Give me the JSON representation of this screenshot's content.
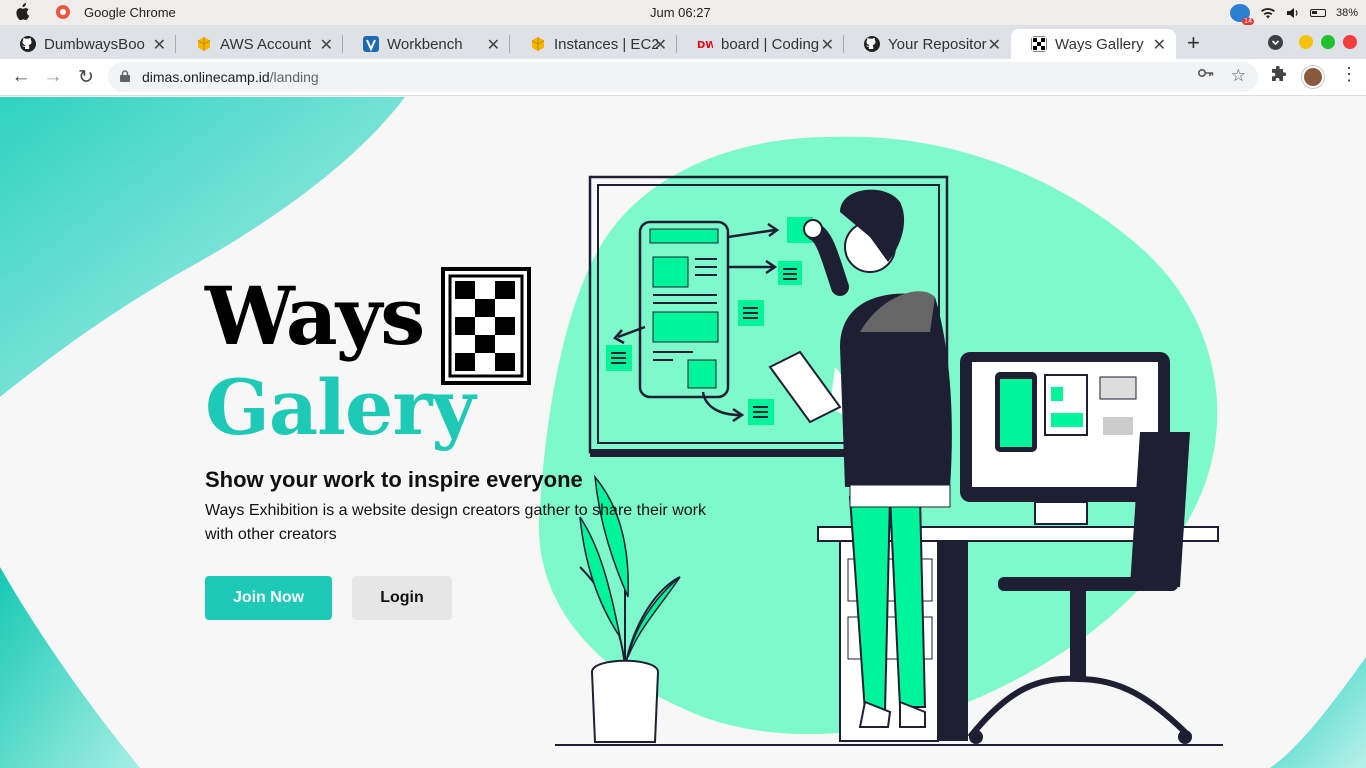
{
  "menubar": {
    "app_name": "Google Chrome",
    "clock": "Jum 06:27",
    "notification_count": "14",
    "battery": "38%"
  },
  "tabs": [
    {
      "label": "DumbwaysBoo",
      "icon": "github-icon"
    },
    {
      "label": "AWS Account",
      "icon": "aws-icon"
    },
    {
      "label": "Workbench",
      "icon": "workbench-icon"
    },
    {
      "label": "Instances | EC2",
      "icon": "aws-icon"
    },
    {
      "label": "board | Coding",
      "icon": "dumbways-icon"
    },
    {
      "label": "Your Repositor",
      "icon": "github-icon"
    },
    {
      "label": "Ways Gallery",
      "icon": "checker-icon",
      "active": true
    }
  ],
  "address": {
    "host": "dimas.onlinecamp.id",
    "path": "/landing"
  },
  "hero": {
    "logo_word1": "Ways",
    "logo_word2": "Galery",
    "tagline": "Show your work to inspire everyone",
    "description": "Ways Exhibition is a website design creators gather to share their work with other creators",
    "join_label": "Join Now",
    "login_label": "Login"
  },
  "colors": {
    "accent": "#1ec9b5",
    "blob": "#7ef9cc",
    "illustration_green": "#00f59b",
    "ink": "#1e1f33"
  }
}
